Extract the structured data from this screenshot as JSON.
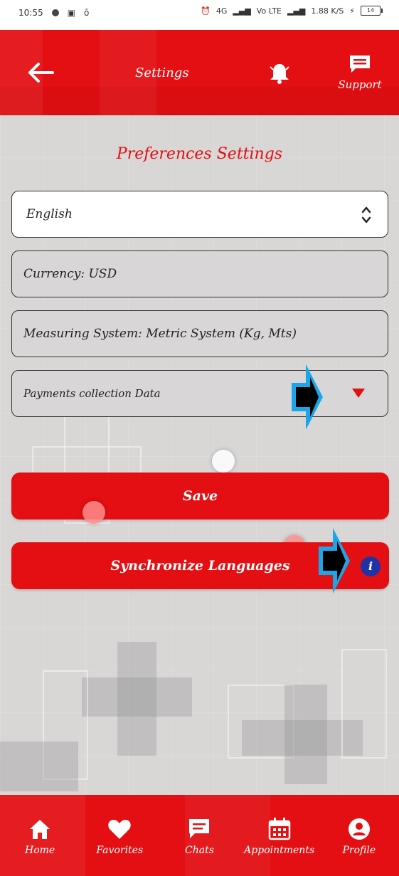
{
  "status_bar": {
    "time": "10:55",
    "network_1": "4G",
    "network_2": "Vo LTE",
    "speed": "1.88 K/S",
    "battery": "14"
  },
  "header": {
    "title": "Settings",
    "support_label": "Support"
  },
  "preferences": {
    "title": "Preferences Settings",
    "language_value": "English",
    "currency": "Currency: USD",
    "measuring_system": "Measuring System: Metric System (Kg, Mts)",
    "payments": "Payments collection Data"
  },
  "actions": {
    "save_label": "Save",
    "sync_label": "Synchronize Languages",
    "info_glyph": "i"
  },
  "nav": {
    "home": "Home",
    "favorites": "Favorites",
    "chats": "Chats",
    "appointments": "Appointments",
    "profile": "Profile"
  },
  "colors": {
    "brand_red": "#e30f12",
    "info_blue": "#1f33a6",
    "background": "#d9d6d6"
  }
}
